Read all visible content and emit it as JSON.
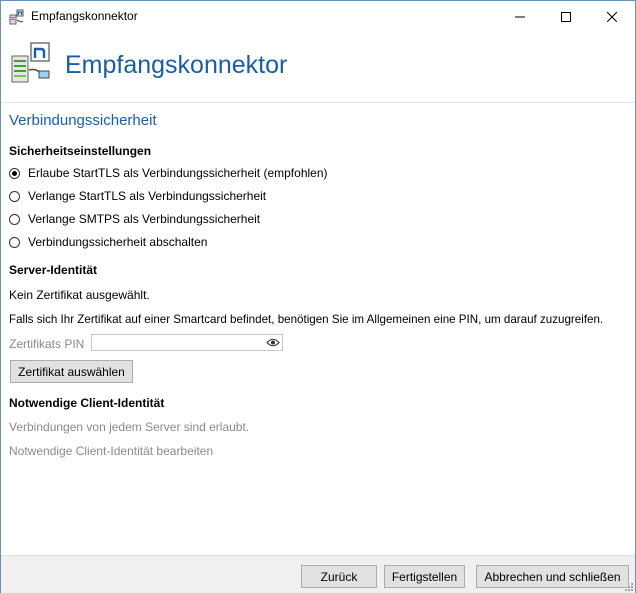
{
  "window": {
    "title": "Empfangskonnektor"
  },
  "header": {
    "title": "Empfangskonnektor"
  },
  "section": {
    "title": "Verbindungssicherheit"
  },
  "security": {
    "heading": "Sicherheitseinstellungen",
    "options": [
      {
        "label": "Erlaube StartTLS als Verbindungssicherheit (empfohlen)",
        "selected": true
      },
      {
        "label": "Verlange StartTLS als Verbindungssicherheit",
        "selected": false
      },
      {
        "label": "Verlange SMTPS als Verbindungssicherheit",
        "selected": false
      },
      {
        "label": "Verbindungssicherheit abschalten",
        "selected": false
      }
    ]
  },
  "server_identity": {
    "heading": "Server-Identität",
    "no_cert": "Kein Zertifikat ausgewählt.",
    "smartcard_note": "Falls sich Ihr Zertifikat auf einer Smartcard befindet, benötigen Sie im Allgemeinen eine PIN, um darauf zuzugreifen.",
    "pin_label": "Zertifikats PIN",
    "pin_value": "",
    "select_button": "Zertifikat auswählen"
  },
  "client_identity": {
    "heading": "Notwendige Client-Identität",
    "status": "Verbindungen von jedem Server sind erlaubt.",
    "edit_link": "Notwendige Client-Identität bearbeiten"
  },
  "footer": {
    "back": "Zurück",
    "finish": "Fertigstellen",
    "cancel": "Abbrechen und schließen"
  },
  "colors": {
    "accent": "#1a5ea8",
    "disabled_text": "#8a8a8a",
    "footer_bg": "#f0f0f0"
  }
}
